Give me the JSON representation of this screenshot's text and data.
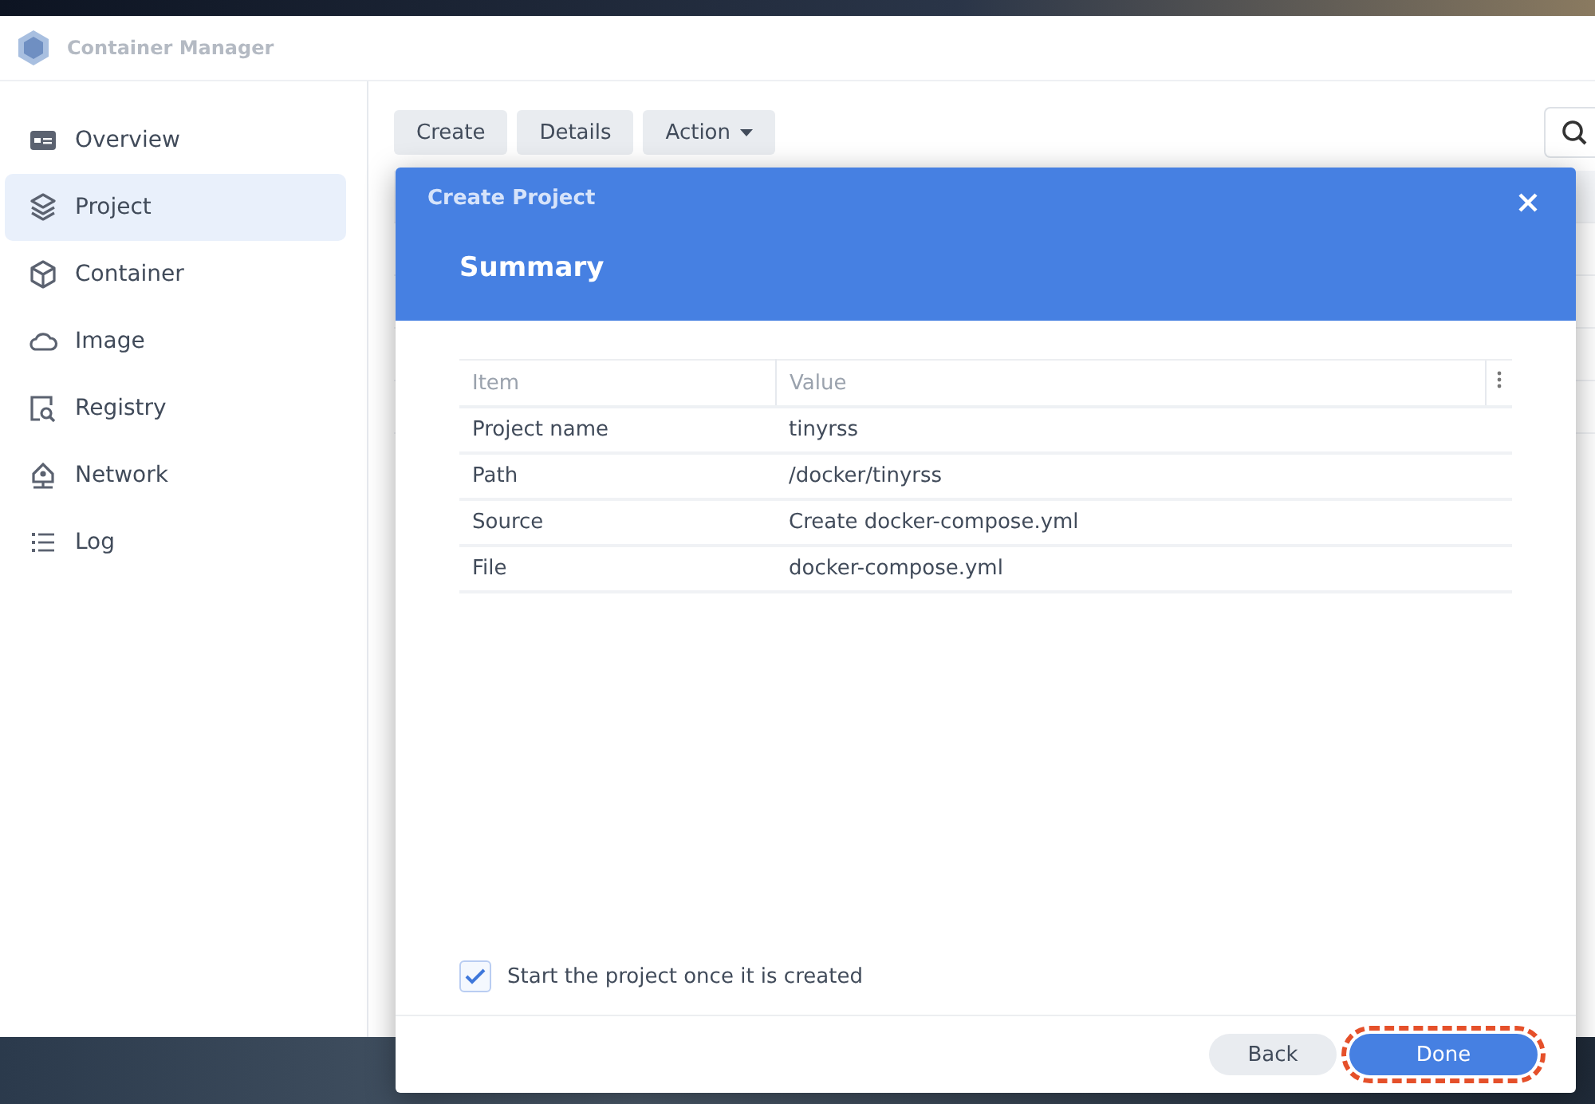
{
  "window": {
    "title": "Container Manager"
  },
  "sidebar": {
    "items": [
      {
        "label": "Overview",
        "selected": false
      },
      {
        "label": "Project",
        "selected": true
      },
      {
        "label": "Container",
        "selected": false
      },
      {
        "label": "Image",
        "selected": false
      },
      {
        "label": "Registry",
        "selected": false
      },
      {
        "label": "Network",
        "selected": false
      },
      {
        "label": "Log",
        "selected": false
      }
    ]
  },
  "toolbar": {
    "buttons": [
      {
        "label": "Create",
        "dropdown": false
      },
      {
        "label": "Details",
        "dropdown": false
      },
      {
        "label": "Action",
        "dropdown": true
      }
    ]
  },
  "dialog": {
    "title": "Create Project",
    "step": "Summary",
    "table": {
      "columns": [
        "Item",
        "Value"
      ],
      "rows": [
        [
          "Project name",
          "tinyrss"
        ],
        [
          "Path",
          "/docker/tinyrss"
        ],
        [
          "Source",
          "Create docker-compose.yml"
        ],
        [
          "File",
          "docker-compose.yml"
        ]
      ]
    },
    "start_option": {
      "label": "Start the project once it is created",
      "checked": true
    },
    "buttons": [
      {
        "label": "Back",
        "kind": "secondary",
        "highlighted": false
      },
      {
        "label": "Done",
        "kind": "primary",
        "highlighted": true
      }
    ]
  }
}
